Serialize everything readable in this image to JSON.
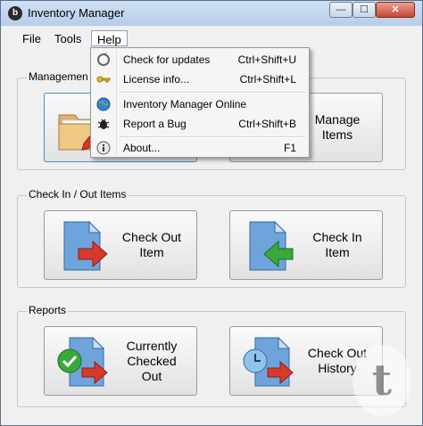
{
  "window": {
    "title": "Inventory Manager",
    "controls": {
      "minimize": "—",
      "maximize": "☐",
      "close": "✕"
    }
  },
  "menubar": {
    "items": [
      {
        "label": "File"
      },
      {
        "label": "Tools"
      },
      {
        "label": "Help"
      }
    ]
  },
  "help_menu": {
    "items": [
      {
        "label": "Check for updates",
        "shortcut": "Ctrl+Shift+U",
        "icon": "update-icon"
      },
      {
        "label": "License info...",
        "shortcut": "Ctrl+Shift+L",
        "icon": "key-icon"
      },
      {
        "label": "Inventory Manager Online",
        "shortcut": "",
        "icon": "globe-icon"
      },
      {
        "label": "Report a Bug",
        "shortcut": "Ctrl+Shift+B",
        "icon": "bug-icon"
      },
      {
        "label": "About...",
        "shortcut": "F1",
        "icon": "info-icon"
      }
    ]
  },
  "groups": {
    "management": {
      "label": "Managemen",
      "buttons": [
        {
          "label": "",
          "icon": "folder-pencil-icon"
        },
        {
          "label": "Manage\nItems",
          "icon": "items-icon"
        }
      ]
    },
    "checkinout": {
      "label": "Check In / Out Items",
      "buttons": [
        {
          "label": "Check Out\nItem",
          "icon": "document-arrow-right-icon"
        },
        {
          "label": "Check In\nItem",
          "icon": "document-arrow-left-icon"
        }
      ]
    },
    "reports": {
      "label": "Reports",
      "buttons": [
        {
          "label": "Currently\nChecked\nOut",
          "icon": "document-check-icon"
        },
        {
          "label": "Check Out\nHistory",
          "icon": "document-clock-icon"
        }
      ]
    }
  },
  "watermark": "t",
  "colors": {
    "arrow_red": "#d83a2a",
    "arrow_green": "#3aa83a",
    "doc_blue": "#6fa3dc"
  }
}
